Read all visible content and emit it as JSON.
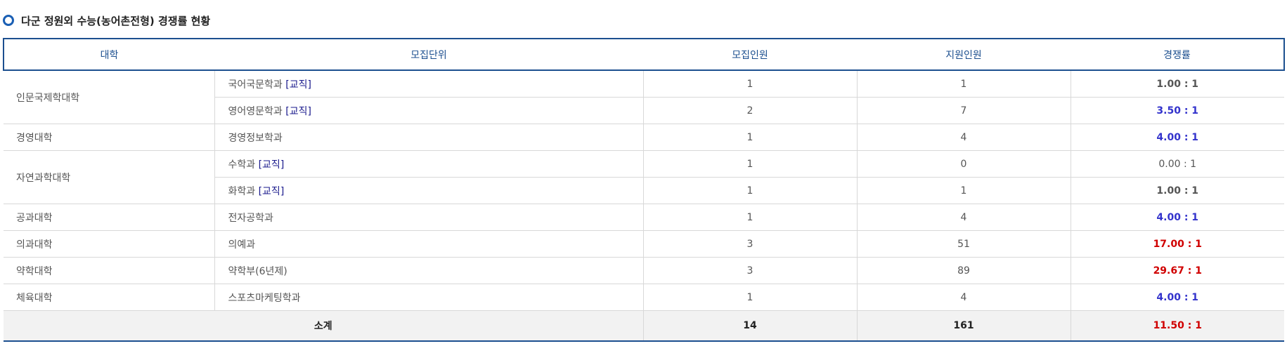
{
  "title": "다군 정원외 수능(농어촌전형) 경쟁률 현황",
  "headers": {
    "univ": "대학",
    "unit": "모집단위",
    "quota": "모집인원",
    "applicants": "지원인원",
    "rate": "경쟁률"
  },
  "teacher_tag": "[교직]",
  "groups": [
    {
      "univ": "인문국제학대학"
    },
    {
      "univ": "경영대학"
    },
    {
      "univ": "자연과학대학"
    },
    {
      "univ": "공과대학"
    },
    {
      "univ": "의과대학"
    },
    {
      "univ": "약학대학"
    },
    {
      "univ": "체육대학"
    }
  ],
  "rows": [
    {
      "unit": "국어국문학과",
      "quota": "1",
      "applicants": "1",
      "rate": "1.00 : 1",
      "rate_color": "gray"
    },
    {
      "unit": "영어영문학과",
      "quota": "2",
      "applicants": "7",
      "rate": "3.50 : 1",
      "rate_color": "blue"
    },
    {
      "unit": "경영정보학과",
      "quota": "1",
      "applicants": "4",
      "rate": "4.00 : 1",
      "rate_color": "blue"
    },
    {
      "unit": "수학과",
      "quota": "1",
      "applicants": "0",
      "rate": "0.00 : 1",
      "rate_color": "zero"
    },
    {
      "unit": "화학과",
      "quota": "1",
      "applicants": "1",
      "rate": "1.00 : 1",
      "rate_color": "gray"
    },
    {
      "unit": "전자공학과",
      "quota": "1",
      "applicants": "4",
      "rate": "4.00 : 1",
      "rate_color": "blue"
    },
    {
      "unit": "의예과",
      "quota": "3",
      "applicants": "51",
      "rate": "17.00 : 1",
      "rate_color": "red"
    },
    {
      "unit": "약학부(6년제)",
      "quota": "3",
      "applicants": "89",
      "rate": "29.67 : 1",
      "rate_color": "red"
    },
    {
      "unit": "스포츠마케팅학과",
      "quota": "1",
      "applicants": "4",
      "rate": "4.00 : 1",
      "rate_color": "blue"
    }
  ],
  "total": {
    "label": "소계",
    "quota": "14",
    "applicants": "161",
    "rate": "11.50 : 1"
  },
  "colors": {
    "header_border": "#1c4f8f",
    "rate_blue": "#3333cc",
    "rate_red": "#d00000",
    "teacher_tag": "#1a1a8c"
  }
}
